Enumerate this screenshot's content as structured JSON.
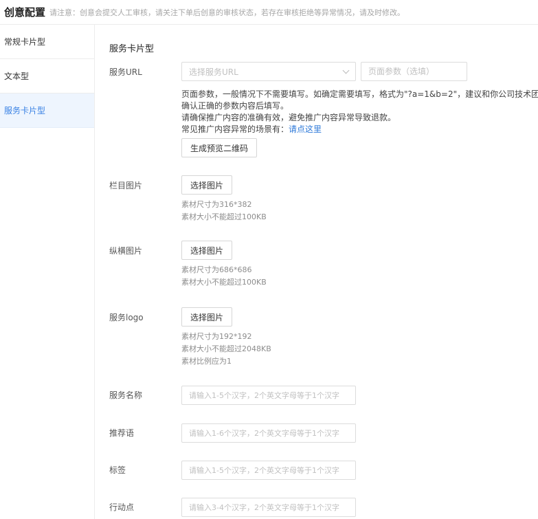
{
  "header": {
    "title": "创意配置",
    "notice": "请注意：创意会提交人工审核，请关注下单后创意的审核状态，若存在审核拒绝等异常情况，请及时修改。"
  },
  "sidebar": {
    "items": [
      {
        "label": "常规卡片型",
        "active": false
      },
      {
        "label": "文本型",
        "active": false
      },
      {
        "label": "服务卡片型",
        "active": true
      }
    ]
  },
  "main": {
    "section_title": "服务卡片型",
    "service_url": {
      "label": "服务URL",
      "select_placeholder": "选择服务URL",
      "page_param_placeholder": "页面参数（选填）",
      "help_lines": [
        "页面参数，一般情况下不需要填写。如确定需要填写，格式为\"?a=1&b=2\"，建议和你公司技术团队",
        "确认正确的参数内容后填写。",
        "请确保推广内容的准确有效，避免推广内容异常导致退款。"
      ],
      "help_common_prefix": "常见推广内容异常的场景有：",
      "help_link": "请点这里",
      "qr_button": "生成预览二维码"
    },
    "column_image": {
      "label": "栏目图片",
      "button": "选择图片",
      "hints": [
        "素材尺寸为316*382",
        "素材大小不能超过100KB"
      ]
    },
    "vertical_image": {
      "label": "纵横图片",
      "button": "选择图片",
      "hints": [
        "素材尺寸为686*686",
        "素材大小不能超过100KB"
      ]
    },
    "service_logo": {
      "label": "服务logo",
      "button": "选择图片",
      "hints": [
        "素材尺寸为192*192",
        "素材大小不能超过2048KB",
        "素材比例应为1"
      ]
    },
    "service_name": {
      "label": "服务名称",
      "placeholder": "请输入1-5个汉字，2个英文字母等于1个汉字"
    },
    "recommend": {
      "label": "推荐语",
      "placeholder": "请输入1-6个汉字，2个英文字母等于1个汉字"
    },
    "tag": {
      "label": "标签",
      "placeholder": "请输入1-5个汉字，2个英文字母等于1个汉字"
    },
    "action": {
      "label": "行动点",
      "placeholder": "请输入3-4个汉字，2个英文字母等于1个汉字"
    }
  }
}
